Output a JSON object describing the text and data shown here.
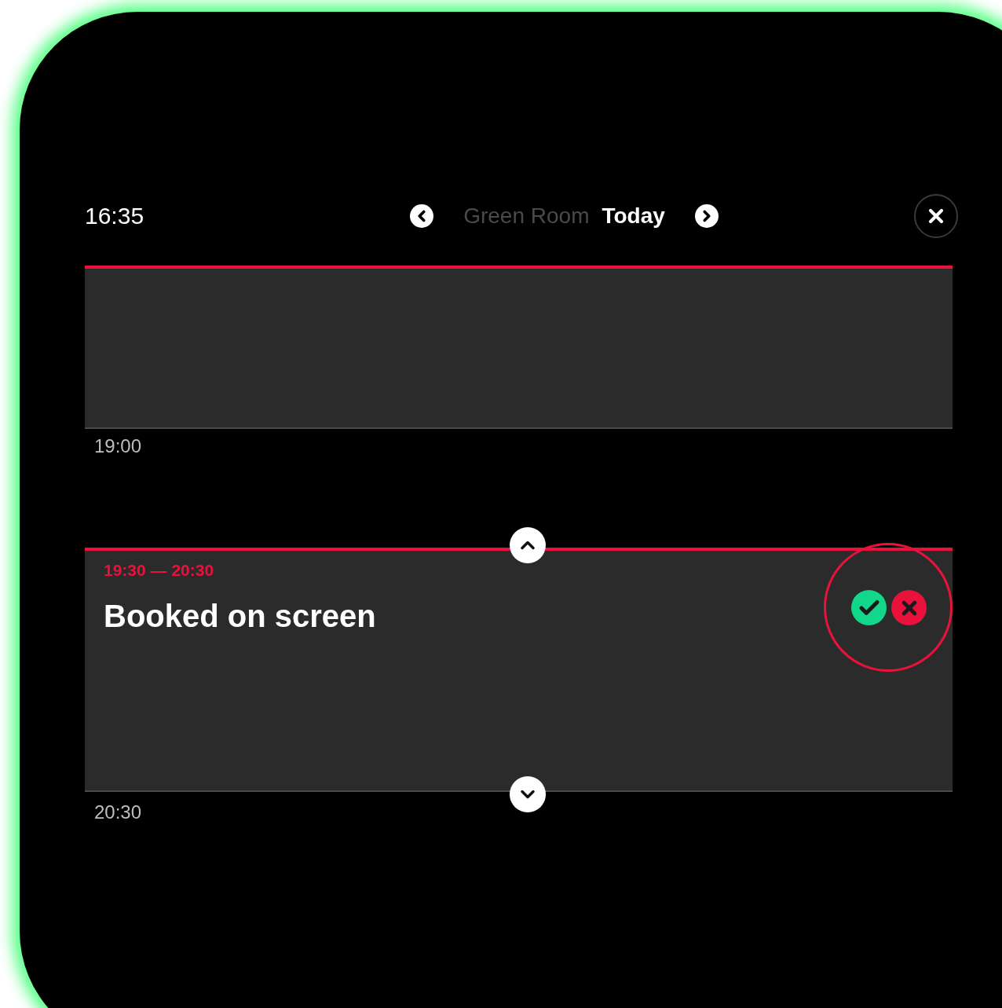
{
  "header": {
    "time": "16:35",
    "room": "Green Room",
    "day": "Today"
  },
  "slots": [
    {
      "kind": "free",
      "end_label": "19:00"
    },
    {
      "kind": "booking",
      "time_range": "19:30 — 20:30",
      "title": "Booked on screen",
      "end_label": "20:30"
    }
  ]
}
